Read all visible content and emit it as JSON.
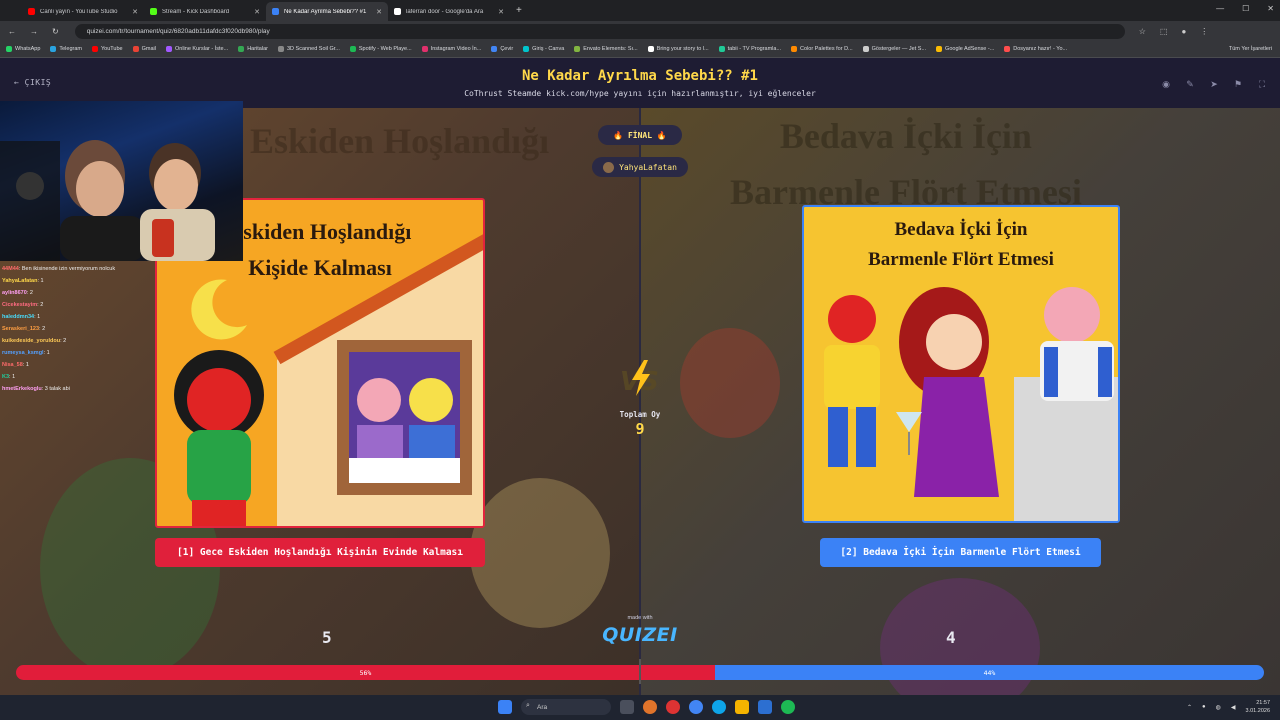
{
  "browser": {
    "tabs": [
      {
        "label": "Canlı yayın - YouTube Studio",
        "color": "#ff0000",
        "active": false
      },
      {
        "label": "Stream - Kick Dashboard",
        "color": "#53fc18",
        "active": false
      },
      {
        "label": "Ne Kadar Ayrılma Sebebi?? #1",
        "color": "#3b82f6",
        "active": true
      },
      {
        "label": "laferrari door - Google'da Ara",
        "color": "#ffffff",
        "active": false
      }
    ],
    "url": "quizei.com/tr/tournament/quiz/6820adb11dafdc3f020db980/play",
    "bookmarks": [
      {
        "label": "WhatsApp",
        "color": "#25d366"
      },
      {
        "label": "Telegram",
        "color": "#2aa3df"
      },
      {
        "label": "YouTube",
        "color": "#ff0000"
      },
      {
        "label": "Gmail",
        "color": "#ea4335"
      },
      {
        "label": "Online Kurslar - İste...",
        "color": "#a259ff"
      },
      {
        "label": "Haritalar",
        "color": "#34a853"
      },
      {
        "label": "3D Scanned Soil Gr...",
        "color": "#888888"
      },
      {
        "label": "Spotify - Web Playe...",
        "color": "#1db954"
      },
      {
        "label": "Instagram Video İn...",
        "color": "#e1306c"
      },
      {
        "label": "Çevir",
        "color": "#4285f4"
      },
      {
        "label": "Giriş - Canva",
        "color": "#00c4cc"
      },
      {
        "label": "Envato Elements: Sı...",
        "color": "#82b541"
      },
      {
        "label": "Bring your story to l...",
        "color": "#ffffff"
      },
      {
        "label": "tabii - TV Programla...",
        "color": "#20c997"
      },
      {
        "label": "Color Palettes for D...",
        "color": "#ff8a00"
      },
      {
        "label": "Göstergeler — Jet S...",
        "color": "#cccccc"
      },
      {
        "label": "Google AdSense -...",
        "color": "#fbbc04"
      },
      {
        "label": "Dosyanız hazır! - Yo...",
        "color": "#ff4d4d"
      }
    ],
    "all_bookmarks": "Tüm Yer İşaretleri"
  },
  "quiz": {
    "exit_label": "ÇIKIŞ",
    "title": "Ne Kadar Ayrılma Sebebi?? #1",
    "subtitle": "CoThrust Steamde kick.com/hype yayını için hazırlanmıştır, iyi eğlenceler",
    "round_badge": "🔥 FİNAL 🔥",
    "user": "YahyaLafatan",
    "total_label": "Toplam Oy",
    "total_votes": "9",
    "left": {
      "card_title_line1": "Eskiden Hoşlandığı",
      "card_title_line2": "Kişide Kalması",
      "option_label": "[1] Gece Eskiden Hoşlandığı Kişinin Evinde Kalması",
      "votes": "5",
      "percent_label": "56%",
      "fraction": 0.56,
      "color": "#e11d3a"
    },
    "right": {
      "card_title_line1": "Bedava İçki İçin",
      "card_title_line2": "Barmenle Flört Etmesi",
      "option_label": "[2] Bedava İçki İçin Barmenle Flört Etmesi",
      "votes": "4",
      "percent_label": "44%",
      "fraction": 0.44,
      "color": "#3b82f6"
    },
    "made_with": "made with",
    "brand": "QUIZEI"
  },
  "chat": [
    {
      "user": "44M44",
      "text": ": Ben ikisinende izin vermiyorum nolcuk",
      "color": "#ff6b6b"
    },
    {
      "user": "YahyaLafatan",
      "text": ": 1",
      "color": "#ffd84a"
    },
    {
      "user": "aylin8670",
      "text": ": 2",
      "color": "#ff9ff3"
    },
    {
      "user": "Cicekestayim",
      "text": ": 2",
      "color": "#ff6b81"
    },
    {
      "user": "haleddmn34",
      "text": ": 1",
      "color": "#48dbfb"
    },
    {
      "user": "Seraskeri_123",
      "text": ": 2",
      "color": "#ff9f43"
    },
    {
      "user": "kuikedeside_yoruldou",
      "text": ": 2",
      "color": "#feca57"
    },
    {
      "user": "rumeysa_ksmgl",
      "text": ": 1",
      "color": "#54a0ff"
    },
    {
      "user": "Nisa_58",
      "text": ": 1",
      "color": "#ff6b6b"
    },
    {
      "user": "K3",
      "text": ": 1",
      "color": "#1dd1a1"
    },
    {
      "user": "hmetErkekoglu",
      "text": ": 3 talak abi",
      "color": "#ff9ff3"
    }
  ],
  "taskbar": {
    "search": "Ara",
    "time": "21:57",
    "date": "3.01.2026"
  }
}
